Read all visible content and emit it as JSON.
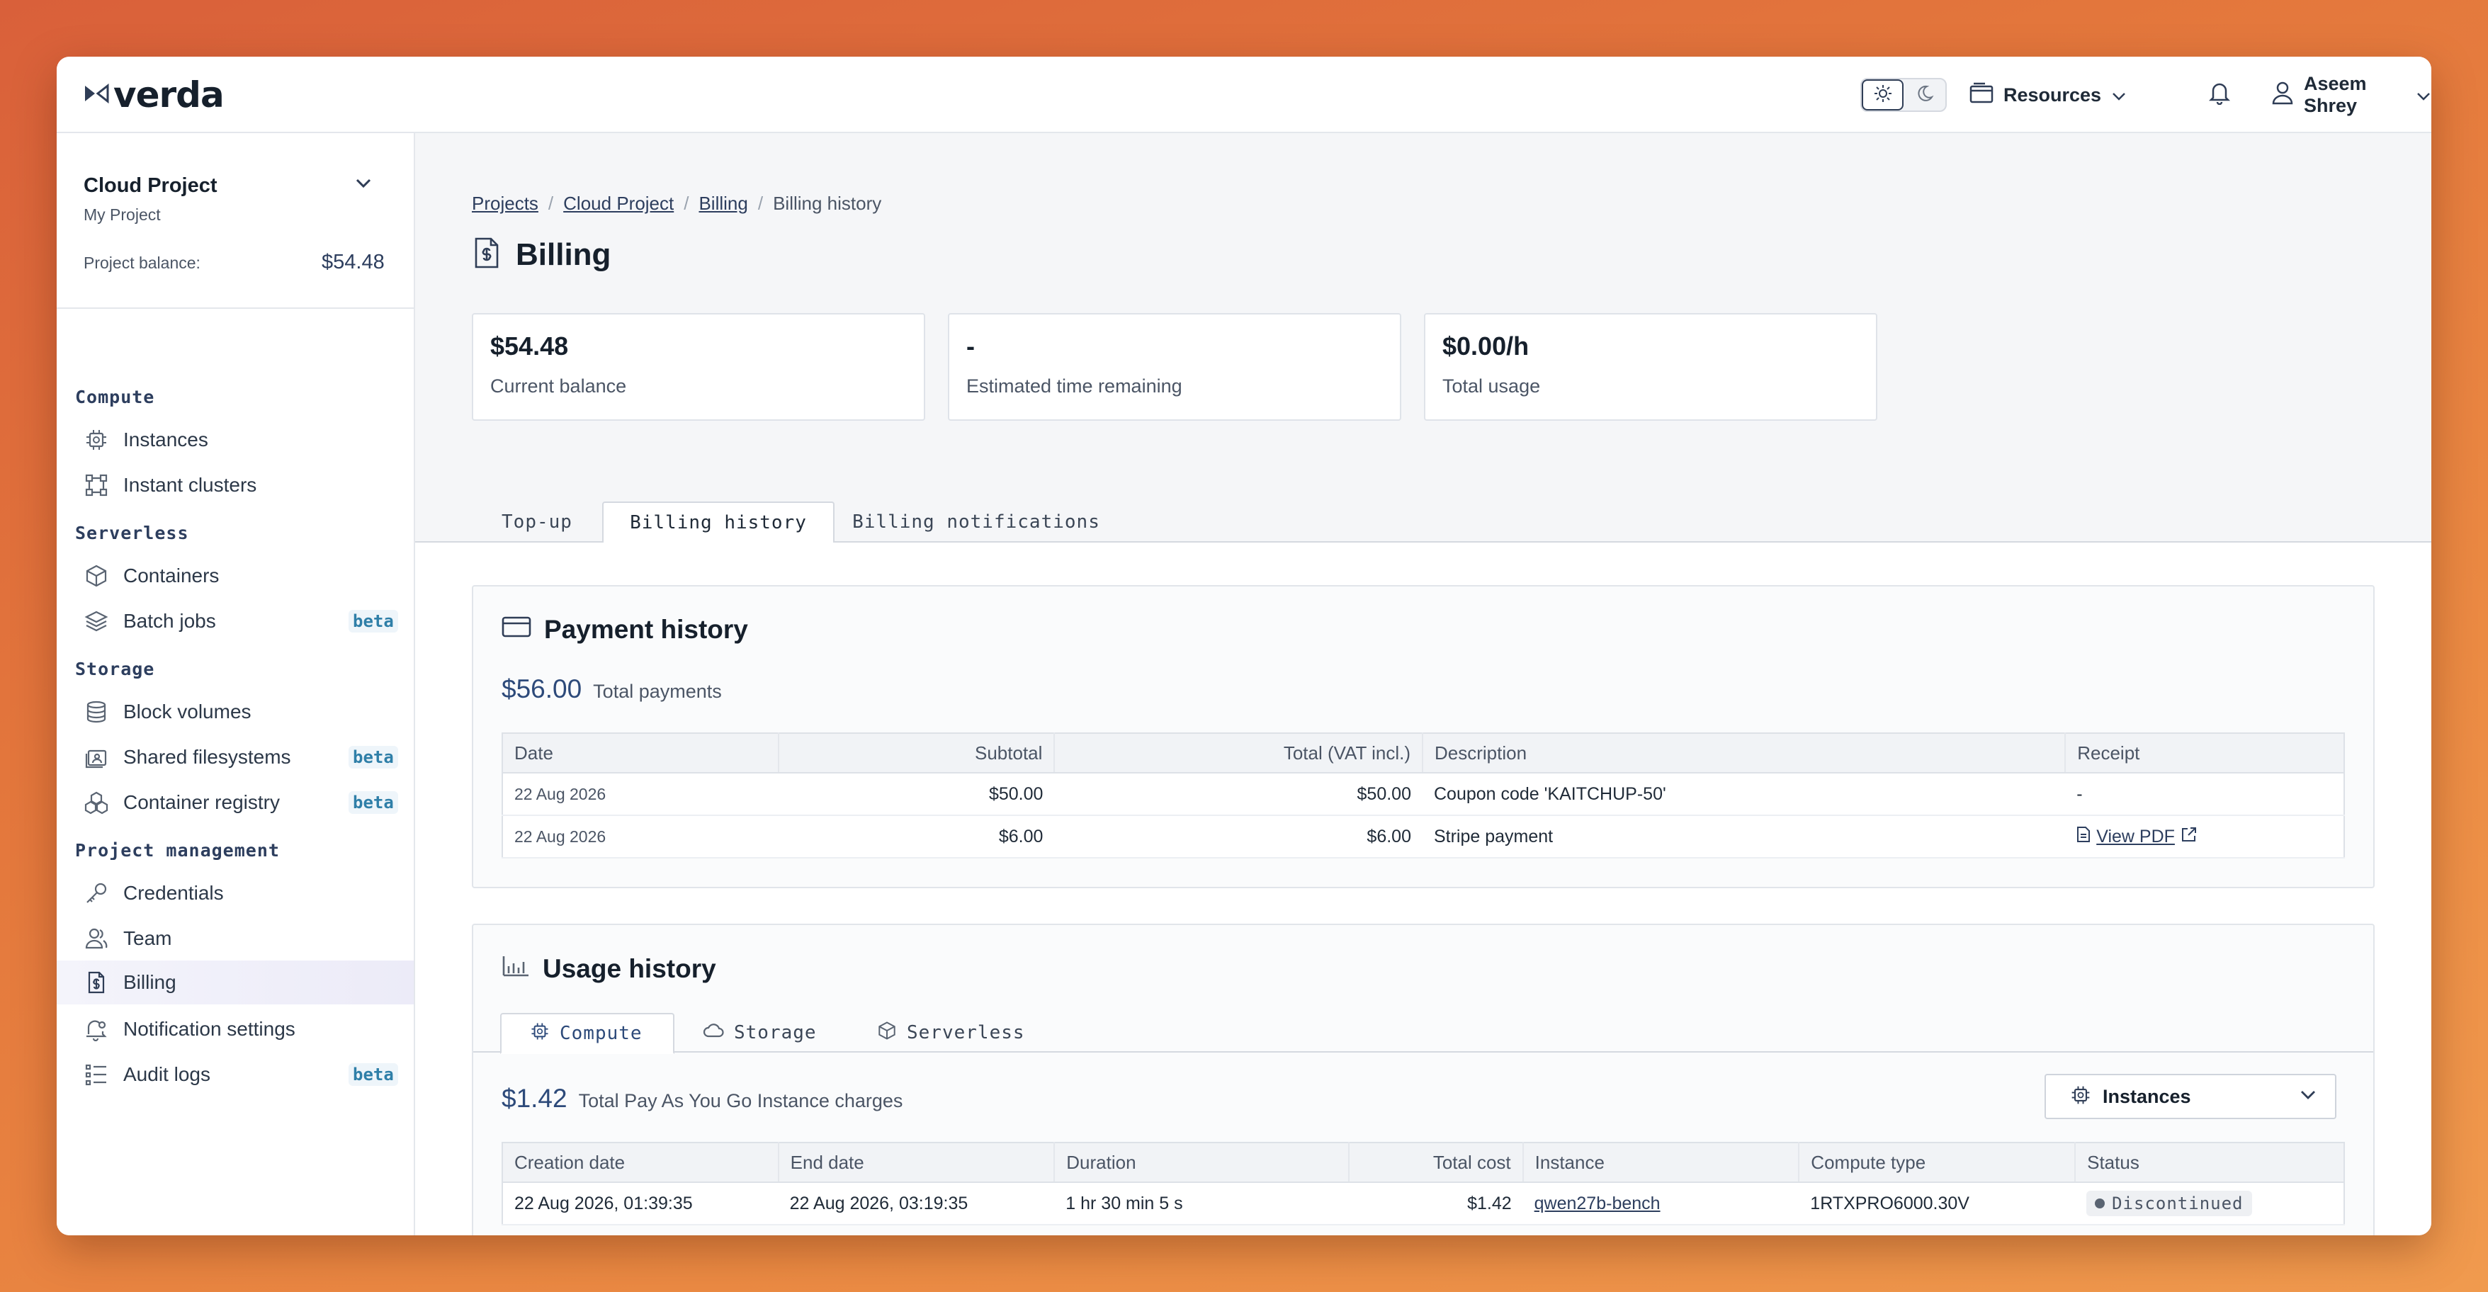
{
  "header": {
    "logo_text": "verda",
    "resources_label": "Resources",
    "user_name": "Aseem Shrey"
  },
  "sidebar": {
    "project_name": "Cloud Project",
    "project_sub": "My Project",
    "balance_label": "Project balance:",
    "balance_value": "$54.48",
    "sections": {
      "compute": "Compute",
      "serverless": "Serverless",
      "storage": "Storage",
      "project_management": "Project management"
    },
    "items": {
      "instances": "Instances",
      "instant_clusters": "Instant clusters",
      "containers": "Containers",
      "batch_jobs": "Batch jobs",
      "block_volumes": "Block volumes",
      "shared_filesystems": "Shared filesystems",
      "container_registry": "Container registry",
      "credentials": "Credentials",
      "team": "Team",
      "billing": "Billing",
      "notification_settings": "Notification settings",
      "audit_logs": "Audit logs"
    },
    "beta_label": "beta"
  },
  "breadcrumb": {
    "projects": "Projects",
    "cloud_project": "Cloud Project",
    "billing": "Billing",
    "current": "Billing history",
    "sep": "/"
  },
  "page_title": "Billing",
  "cards": {
    "balance_value": "$54.48",
    "balance_label": "Current balance",
    "time_value": "-",
    "time_label": "Estimated time remaining",
    "usage_value": "$0.00/h",
    "usage_label": "Total usage"
  },
  "tabs": {
    "topup": "Top-up",
    "history": "Billing history",
    "notifications": "Billing notifications"
  },
  "payment": {
    "title": "Payment history",
    "total": "$56.00",
    "total_label": "Total payments",
    "columns": [
      "Date",
      "Subtotal",
      "Total (VAT incl.)",
      "Description",
      "Receipt"
    ],
    "rows": [
      {
        "date": "22 Aug 2026",
        "subtotal": "$50.00",
        "total": "$50.00",
        "description": "Coupon code 'KAITCHUP-50'",
        "receipt": "-"
      },
      {
        "date": "22 Aug 2026",
        "subtotal": "$6.00",
        "total": "$6.00",
        "description": "Stripe payment",
        "receipt": "View PDF"
      }
    ]
  },
  "usage": {
    "title": "Usage history",
    "subtabs": {
      "compute": "Compute",
      "storage": "Storage",
      "serverless": "Serverless"
    },
    "total": "$1.42",
    "total_label": "Total Pay As You Go Instance charges",
    "select_value": "Instances",
    "columns": [
      "Creation date",
      "End date",
      "Duration",
      "Total cost",
      "Instance",
      "Compute type",
      "Status"
    ],
    "rows": [
      {
        "created": "22 Aug 2026, 01:39:35",
        "ended": "22 Aug 2026, 03:19:35",
        "duration": "1 hr 30 min 5 s",
        "cost": "$1.42",
        "instance": "qwen27b-bench",
        "type": "1RTXPRO6000.30V",
        "status": "Discontinued"
      }
    ]
  }
}
